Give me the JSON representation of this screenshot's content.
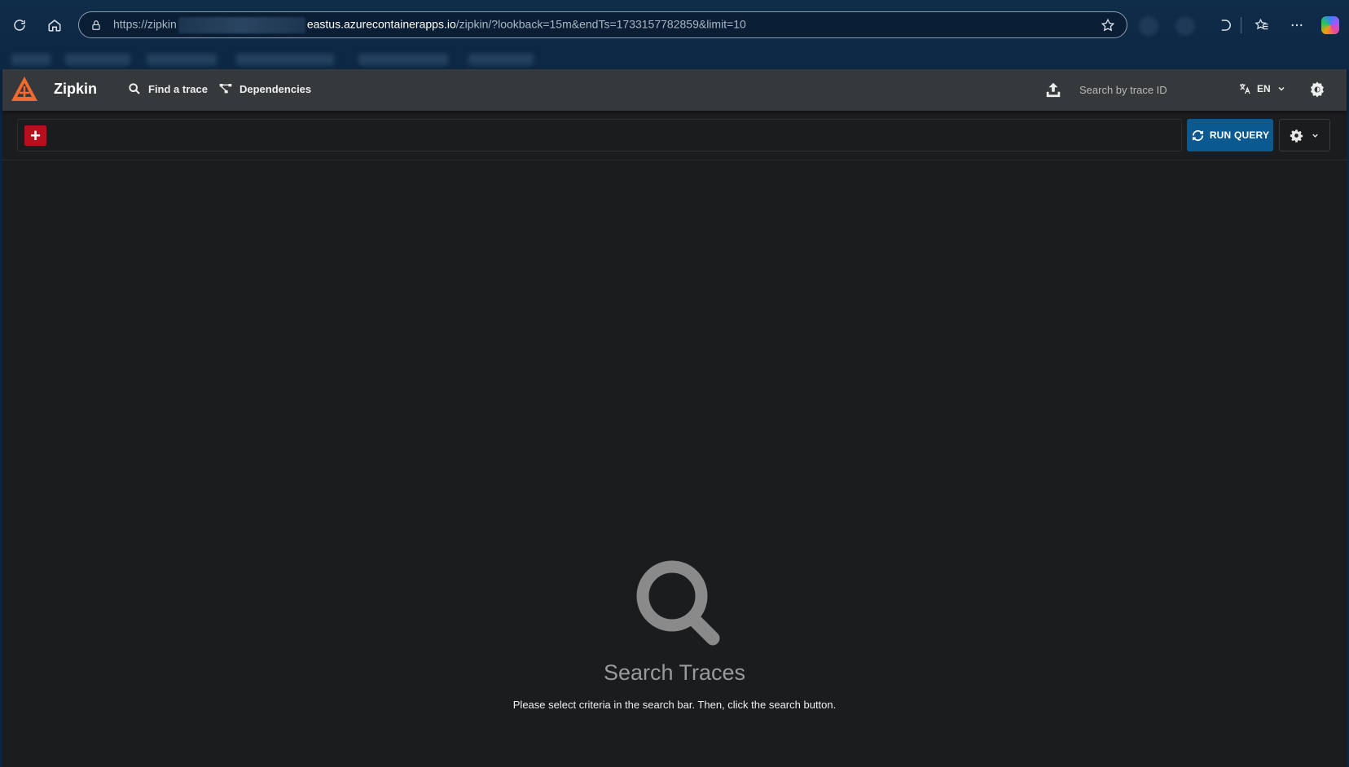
{
  "browser": {
    "url_prefix": "https://zipkin",
    "url_host": "eastus.azurecontainerapps.io",
    "url_path": "/zipkin/?lookback=15m&endTs=1733157782859&limit=10"
  },
  "header": {
    "brand": "Zipkin",
    "nav": [
      {
        "label": "Find a trace",
        "icon": "search-icon"
      },
      {
        "label": "Dependencies",
        "icon": "dependencies-icon"
      }
    ],
    "trace_search_placeholder": "Search by trace ID",
    "language": "EN"
  },
  "toolbar": {
    "add_label": "+",
    "run_query_label": "RUN QUERY"
  },
  "empty_state": {
    "title": "Search Traces",
    "message": "Please select criteria in the search bar. Then, click the search button."
  },
  "colors": {
    "brand_orange": "#f46a2c",
    "add_red": "#b5101e",
    "run_query_blue": "#0a5a91",
    "header_bg": "#35393b",
    "page_bg": "#1b1c1e"
  }
}
